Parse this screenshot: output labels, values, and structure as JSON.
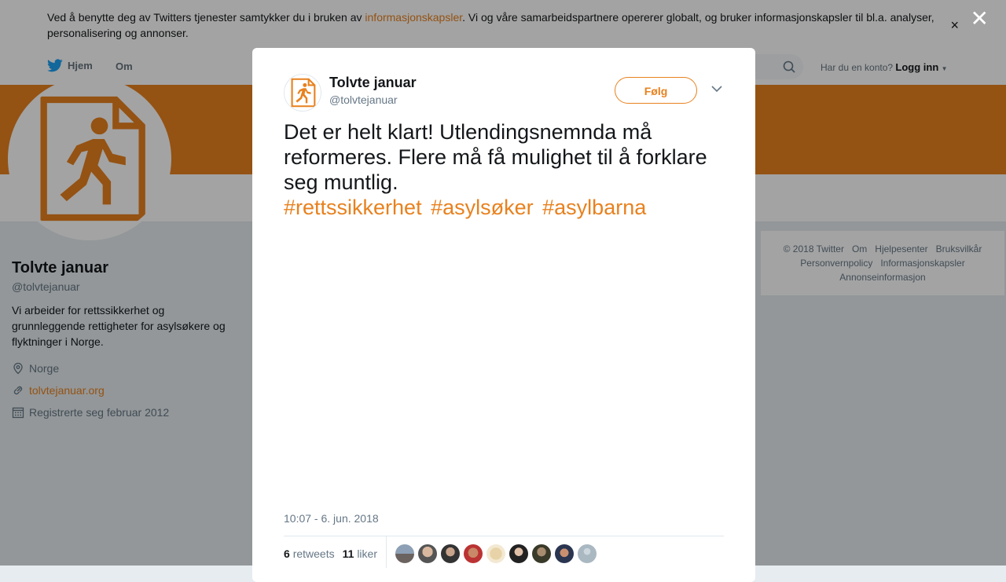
{
  "cookie_bar": {
    "text_before": "Ved å benytte deg av Twitters tjenester samtykker du i bruken av ",
    "link": "informasjonskapsler",
    "text_after": ". Vi og våre samarbeidspartnere opererer globalt, og bruker informasjonskapsler til bl.a. analyser, personalisering og annonser.",
    "close": "×"
  },
  "nav": {
    "home": "Hjem",
    "about": "Om",
    "login_prompt": "Har du en konto?",
    "login": "Logg inn"
  },
  "profile": {
    "name": "Tolvte januar",
    "handle": "@tolvtejanuar",
    "bio": "Vi arbeider for rettssikkerhet og grunnleggende rettigheter for asylsøkere og flyktninger i Norge.",
    "location": "Norge",
    "website": "tolvtejanuar.org",
    "joined": "Registrerte seg februar 2012"
  },
  "footer": {
    "links": [
      "© 2018 Twitter",
      "Om",
      "Hjelpesenter",
      "Bruksvilkår",
      "Personvernpolicy",
      "Informasjonskapsler",
      "Annonseinformasjon"
    ]
  },
  "overlay": {
    "close": "✕"
  },
  "tweet": {
    "name": "Tolvte januar",
    "handle": "@tolvtejanuar",
    "follow": "Følg",
    "text": "Det er helt klart! Utlendingsnemnda må reformeres. Flere må få mulighet til å forklare seg muntlig.",
    "hashtags": [
      "#rettssikkerhet",
      "#asylsøker",
      "#asylbarna"
    ],
    "time": "10:07 - 6. jun. 2018",
    "retweets_count": "6",
    "retweets_label": "retweets",
    "likes_count": "11",
    "likes_label": "liker"
  },
  "colors": {
    "accent": "#e8811e",
    "text": "#14171a",
    "muted": "#657786"
  }
}
